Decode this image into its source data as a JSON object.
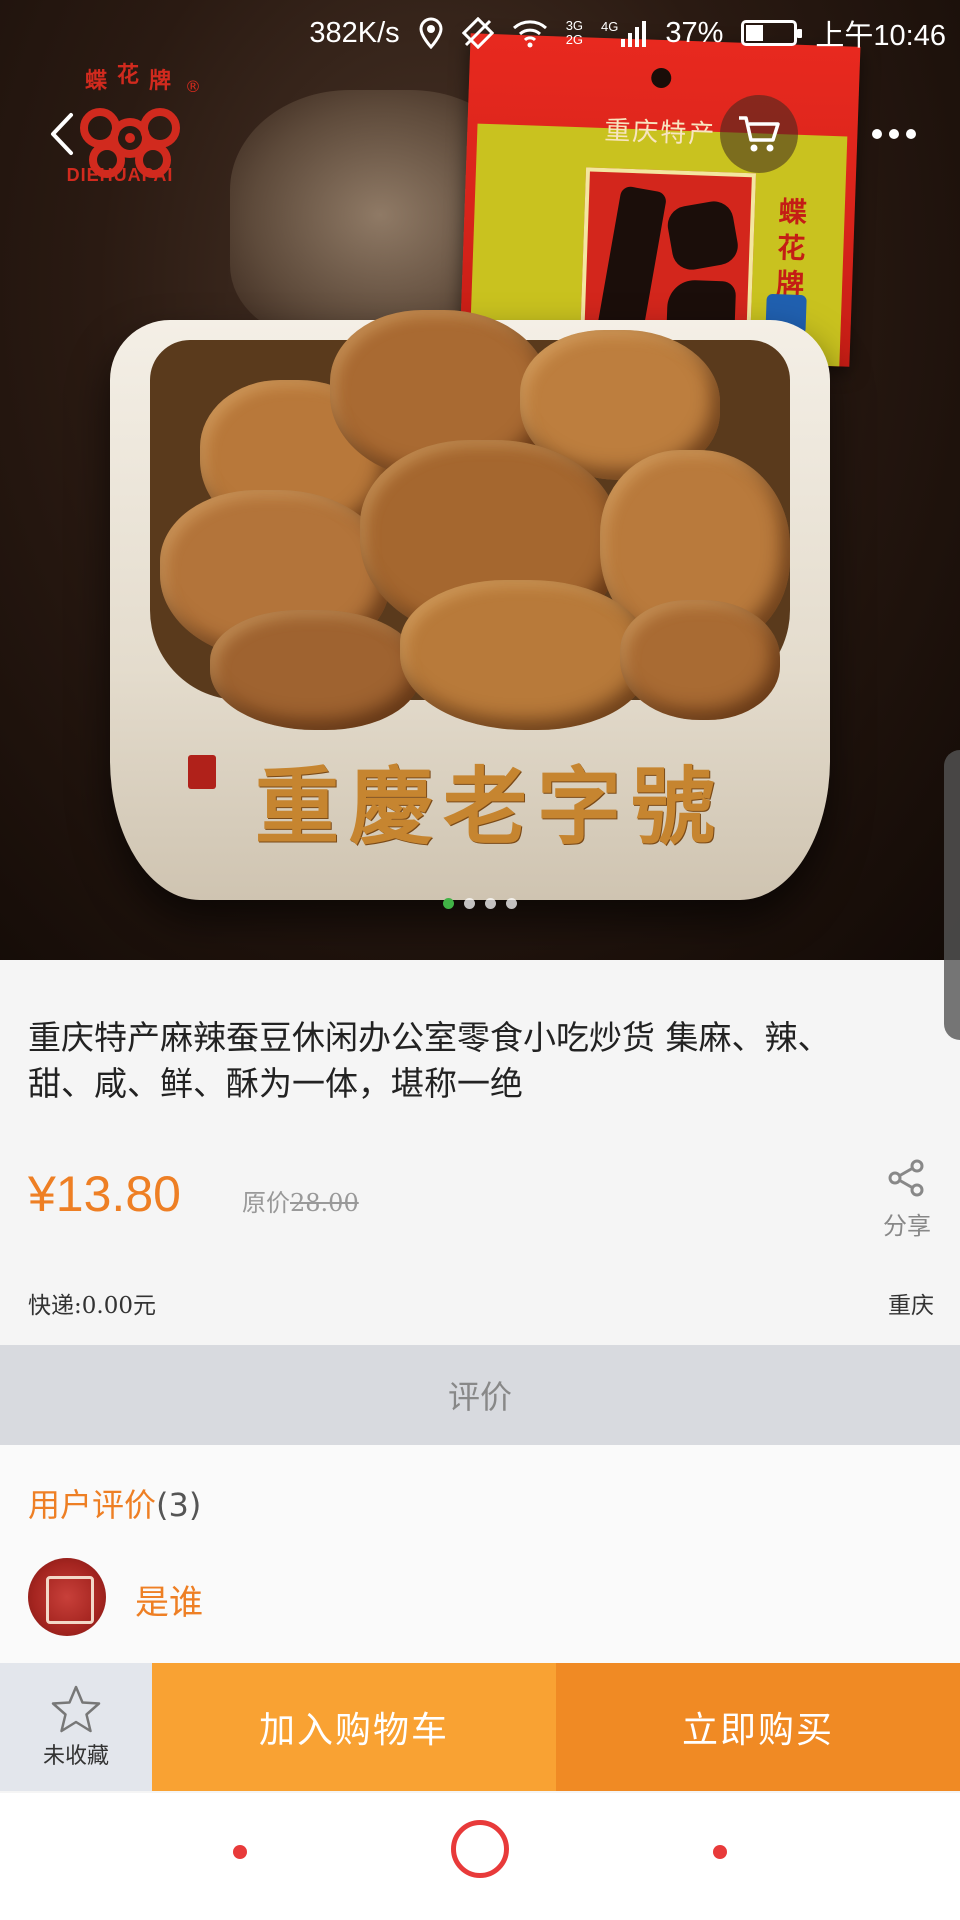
{
  "status_bar": {
    "net_speed": "382K/s",
    "net_3g": "3G",
    "net_2g": "2G",
    "net_4g": "4G",
    "battery": "37%",
    "battery_level": 0.37,
    "time": "上午10:46"
  },
  "hero": {
    "brand_logo_text": "DIEHUAPAI",
    "packet_tag": "重庆特产",
    "packet_side_text": "蝶花牌",
    "bowl_text": "重慶老字號",
    "carousel": {
      "count": 4,
      "active_index": 0
    }
  },
  "product": {
    "title": "重庆特产麻辣蚕豆休闲办公室零食小吃炒货 集麻、辣、甜、咸、鲜、酥为一体，堪称一绝",
    "price": "¥13.80",
    "original_label": "原价",
    "original_price": "28.00",
    "share_label": "分享",
    "shipping": "快递:0.00元",
    "location": "重庆"
  },
  "reviews": {
    "header": "评价",
    "title": "用户评价",
    "count": "(3)",
    "first_user": "是谁"
  },
  "actions": {
    "favorite_label": "未收藏",
    "add_to_cart": "加入购物车",
    "buy_now": "立即购买"
  },
  "colors": {
    "accent": "#ee7f24",
    "add_cart_bg": "#f9a233",
    "buy_now_bg": "#f08a24",
    "carousel_active": "#41b346",
    "nav_red": "#e83a3a"
  }
}
